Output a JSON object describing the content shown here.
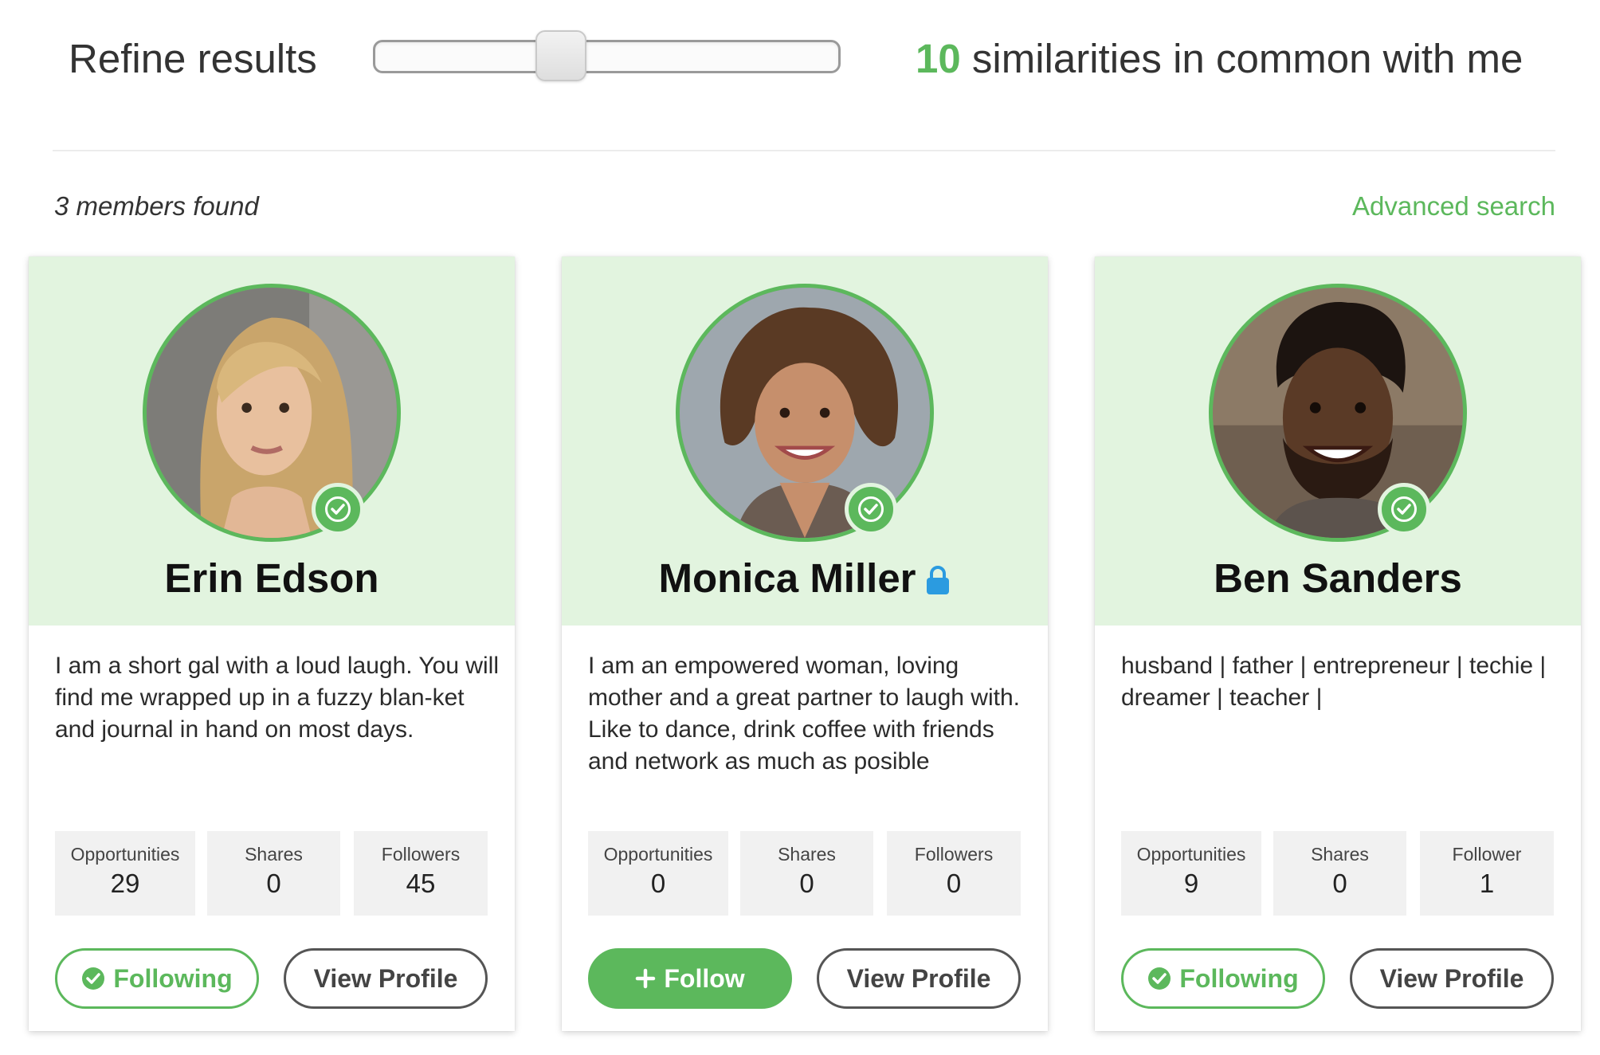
{
  "refine": {
    "title": "Refine results",
    "slider_value": 10,
    "similarities_count": "10",
    "similarities_text": " similarities in common with me"
  },
  "results": {
    "members_found": "3 members found",
    "advanced_search": "Advanced search"
  },
  "colors": {
    "accent": "#5cb85c",
    "card_header_bg": "#e2f4df",
    "lock": "#2b9be0"
  },
  "members": [
    {
      "name": "Erin Edson",
      "locked": false,
      "bio": "I am a short gal with a loud laugh. You will find me wrapped up in a fuzzy blan-ket and journal in hand on most days.",
      "stats": [
        {
          "label": "Opportunities",
          "value": "29"
        },
        {
          "label": "Shares",
          "value": "0"
        },
        {
          "label": "Followers",
          "value": "45"
        }
      ],
      "follow_state": "following",
      "follow_label": "Following",
      "view_label": "View Profile"
    },
    {
      "name": "Monica Miller",
      "locked": true,
      "bio": "I am an empowered woman, loving mother and a great partner to laugh with. Like to dance, drink coffee with friends and network as much as posible",
      "stats": [
        {
          "label": "Opportunities",
          "value": "0"
        },
        {
          "label": "Shares",
          "value": "0"
        },
        {
          "label": "Followers",
          "value": "0"
        }
      ],
      "follow_state": "follow",
      "follow_label": "Follow",
      "view_label": "View Profile"
    },
    {
      "name": "Ben Sanders",
      "locked": false,
      "bio": "husband | father | entrepreneur | techie | dreamer | teacher |",
      "stats": [
        {
          "label": "Opportunities",
          "value": "9"
        },
        {
          "label": "Shares",
          "value": "0"
        },
        {
          "label": "Follower",
          "value": "1"
        }
      ],
      "follow_state": "following",
      "follow_label": "Following",
      "view_label": "View Profile"
    }
  ]
}
